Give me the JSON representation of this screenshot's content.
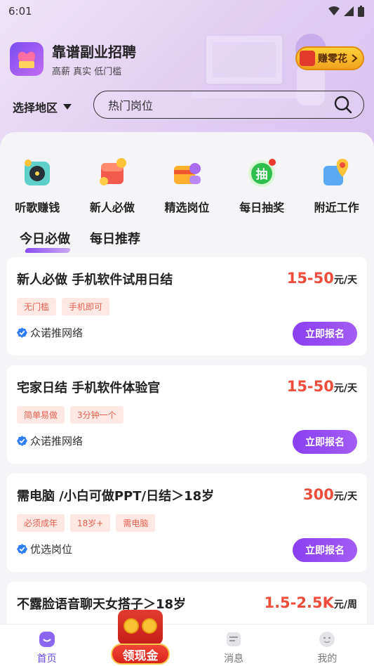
{
  "status": {
    "time": "6:01"
  },
  "app": {
    "title": "靠谱副业招聘",
    "subtitle": "高薪 真实 低门槛",
    "earn_label": "赚零花"
  },
  "search": {
    "region_label": "选择地区",
    "placeholder": "热门岗位"
  },
  "shortcuts": [
    {
      "label": "听歌赚钱",
      "icon": "music-disc-icon"
    },
    {
      "label": "新人必做",
      "icon": "red-envelope-icon"
    },
    {
      "label": "精选岗位",
      "icon": "briefcase-icon"
    },
    {
      "label": "每日抽奖",
      "icon": "lottery-icon",
      "badge": "抽"
    },
    {
      "label": "附近工作",
      "icon": "map-pin-icon"
    }
  ],
  "tabs": [
    {
      "label": "今日必做",
      "active": true
    },
    {
      "label": "每日推荐",
      "active": false
    }
  ],
  "jobs": [
    {
      "title": "新人必做 手机软件试用日结",
      "salary": "15-50",
      "unit": "元/天",
      "tags": [
        "无门槛",
        "手机即可"
      ],
      "company": "众诺推网络",
      "apply": "立即报名"
    },
    {
      "title": "宅家日结 手机软件体验官",
      "salary": "15-50",
      "unit": "元/天",
      "tags": [
        "简单易做",
        "3分钟一个"
      ],
      "company": "众诺推网络",
      "apply": "立即报名"
    },
    {
      "title": "需电脑 /小白可做PPT/日结＞18岁",
      "salary": "300",
      "unit": "元/天",
      "tags": [
        "必须成年",
        "18岁+",
        "需电脑"
      ],
      "company": "优选岗位",
      "apply": "立即报名"
    },
    {
      "title": "不露脸语音聊天女搭子＞18岁",
      "salary": "1.5-2.5K",
      "unit": "元/周"
    }
  ],
  "nav": {
    "home": "首页",
    "cash": "领现金",
    "messages": "消息",
    "me": "我的"
  },
  "colors": {
    "accent": "#8a3ff0",
    "salary": "#ee4d3c",
    "tag_bg": "#fde8e4"
  }
}
